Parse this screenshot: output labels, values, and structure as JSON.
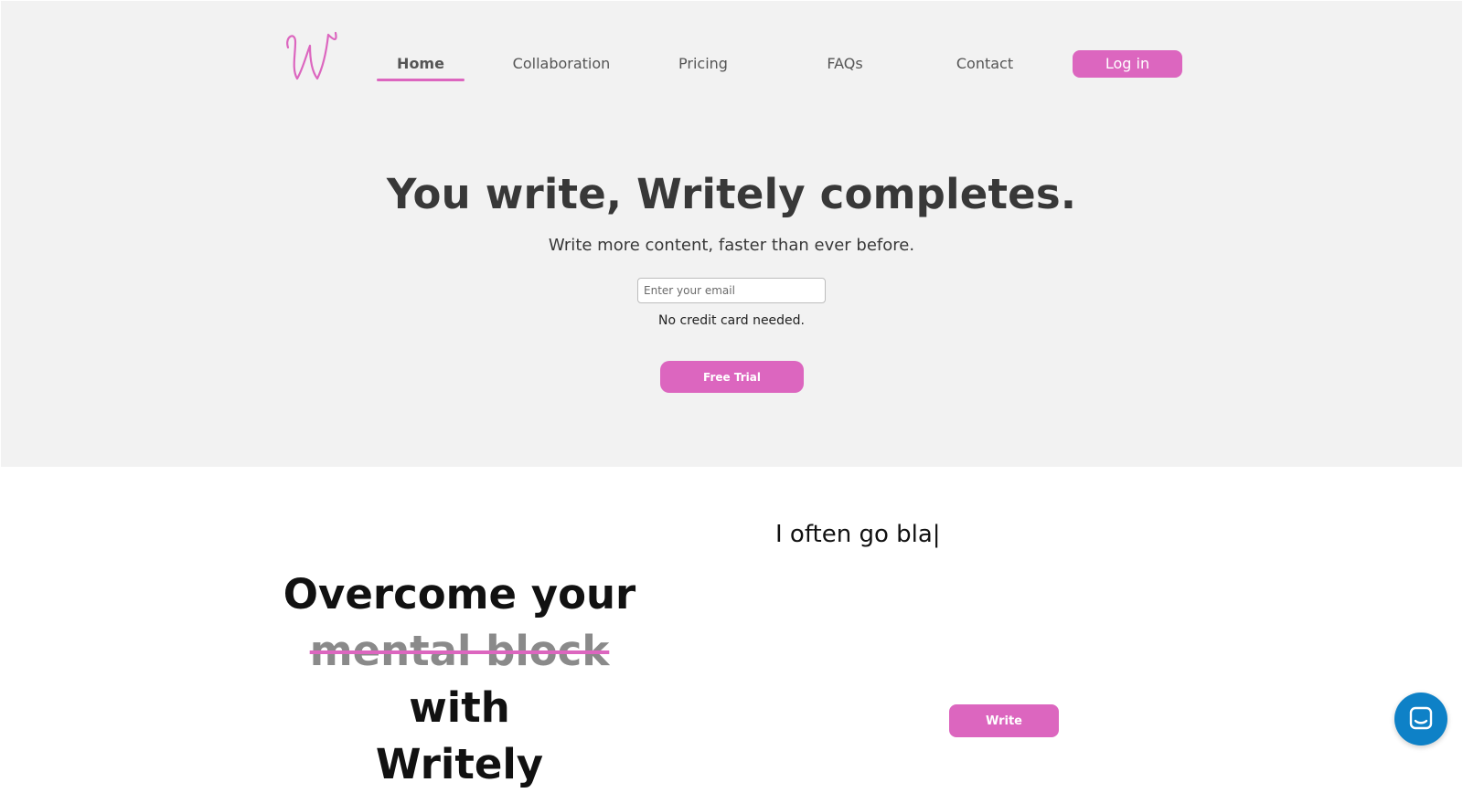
{
  "nav": {
    "items": [
      {
        "label": "Home",
        "active": true
      },
      {
        "label": "Collaboration",
        "active": false
      },
      {
        "label": "Pricing",
        "active": false
      },
      {
        "label": "FAQs",
        "active": false
      },
      {
        "label": "Contact",
        "active": false
      }
    ],
    "login_label": "Log in"
  },
  "hero": {
    "title": "You write, Writely completes.",
    "subtitle": "Write more content, faster than ever before.",
    "email_placeholder": "Enter your email",
    "note": "No credit card needed.",
    "cta_label": "Free Trial"
  },
  "feature": {
    "line1": "Overcome your",
    "struck": "mental block",
    "after_struck": " with",
    "line3": "Writely",
    "typing_text": "I often go bla|",
    "write_label": "Write"
  },
  "colors": {
    "accent": "#dc66bf",
    "hero_bg": "#f2f2f2",
    "chat_launcher": "#0e81c7"
  },
  "icons": {
    "logo": "writely-logo",
    "chat": "chat-icon"
  }
}
